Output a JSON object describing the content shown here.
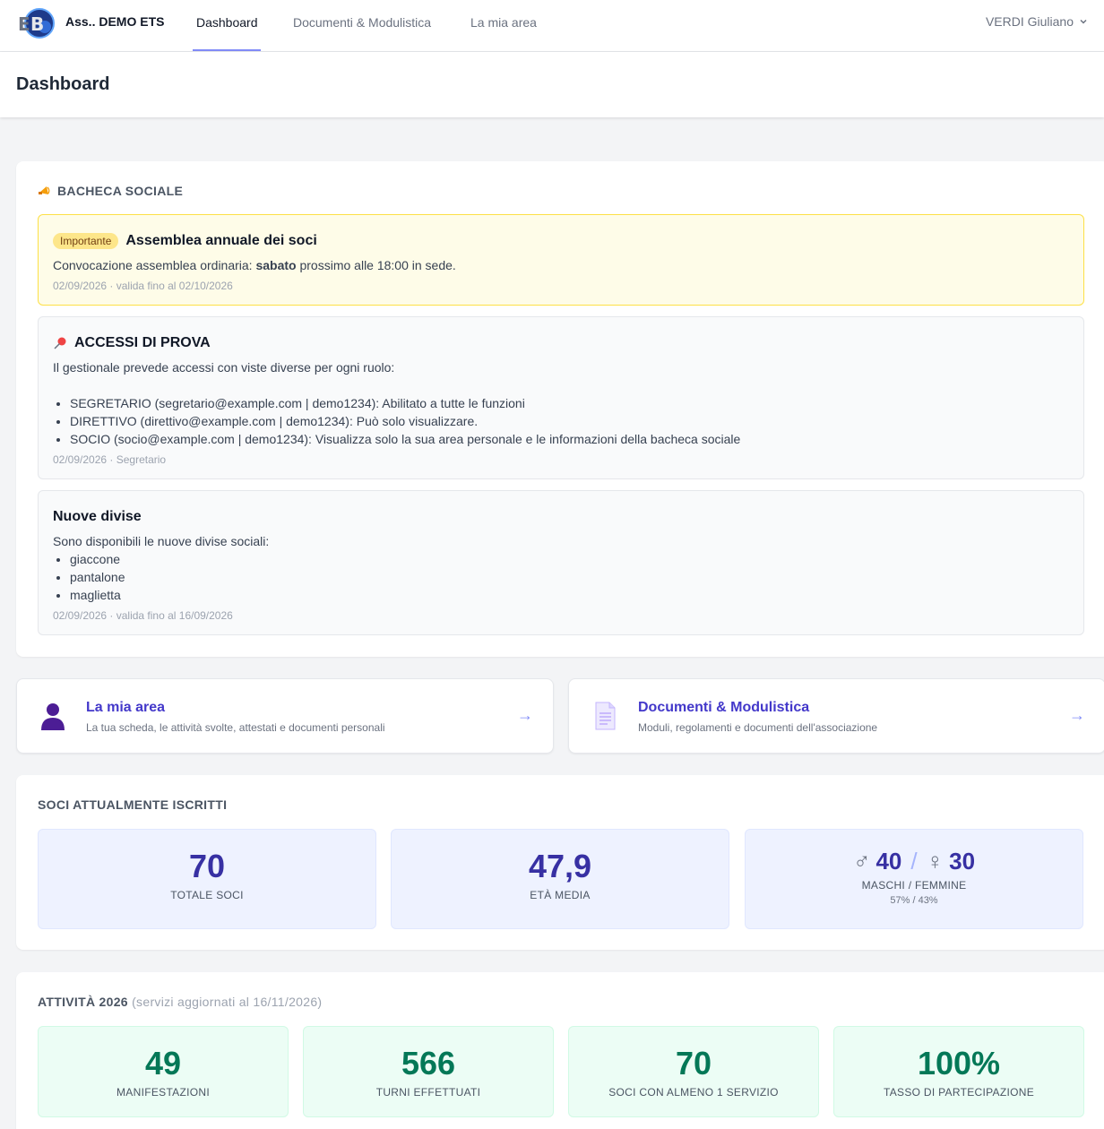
{
  "nav": {
    "brand": "Ass.. DEMO ETS",
    "links": [
      "Dashboard",
      "Documenti & Modulistica",
      "La mia area"
    ],
    "user": "VERDI Giuliano"
  },
  "page": {
    "title": "Dashboard"
  },
  "bacheca": {
    "title": "BACHECA SOCIALE",
    "notices": [
      {
        "badge": "Importante",
        "title": "Assemblea annuale dei soci",
        "body_pre": "Convocazione assemblea ordinaria: ",
        "body_bold": "sabato",
        "body_post": " prossimo alle 18:00 in sede.",
        "meta": "02/09/2026 · valida fino al 02/10/2026"
      },
      {
        "title": "ACCESSI DI PROVA",
        "body": "Il gestionale prevede accessi con viste diverse per ogni ruolo:",
        "items": [
          "SEGRETARIO (segretario@example.com | demo1234): Abilitato a tutte le funzioni",
          "DIRETTIVO (direttivo@example.com | demo1234): Può solo visualizzare.",
          "SOCIO (socio@example.com | demo1234): Visualizza solo la sua area personale e le informazioni della bacheca sociale"
        ],
        "meta": "02/09/2026 · Segretario"
      },
      {
        "title": "Nuove divise",
        "body": "Sono disponibili le nuove divise sociali:",
        "items": [
          "giaccone",
          "pantalone",
          "maglietta"
        ],
        "meta": "02/09/2026 · valida fino al 16/09/2026"
      }
    ]
  },
  "links": [
    {
      "title": "La mia area",
      "desc": "La tua scheda, le attività svolte, attestati e documenti personali",
      "arrow": "→"
    },
    {
      "title": "Documenti & Modulistica",
      "desc": "Moduli, regolamenti e documenti dell'associazione",
      "arrow": "→"
    }
  ],
  "soci": {
    "title": "SOCI ATTUALMENTE ISCRITTI",
    "totale": {
      "value": "70",
      "label": "TOTALE SOCI"
    },
    "eta": {
      "value": "47,9",
      "label": "ETÀ MEDIA"
    },
    "genere": {
      "male_symbol": "♂",
      "male": "40",
      "sep": "/",
      "female_symbol": "♀",
      "female": "30",
      "label": "MASCHI / FEMMINE",
      "pct": "57% / 43%"
    }
  },
  "attivita": {
    "title": "ATTIVITÀ 2026",
    "subtitle": "(servizi aggiornati al 16/11/2026)",
    "items": [
      {
        "value": "49",
        "label": "MANIFESTAZIONI"
      },
      {
        "value": "566",
        "label": "TURNI EFFETTUATI"
      },
      {
        "value": "70",
        "label": "SOCI CON ALMENO 1 SERVIZIO"
      },
      {
        "value": "100%",
        "label": "TASSO DI PARTECIPAZIONE"
      }
    ]
  },
  "colors": {
    "accent": "#4338ca",
    "stat_bg": "#eef2ff",
    "activity_bg": "#ecfdf5",
    "activity_text": "#047857",
    "important_bg": "#fefce8"
  }
}
